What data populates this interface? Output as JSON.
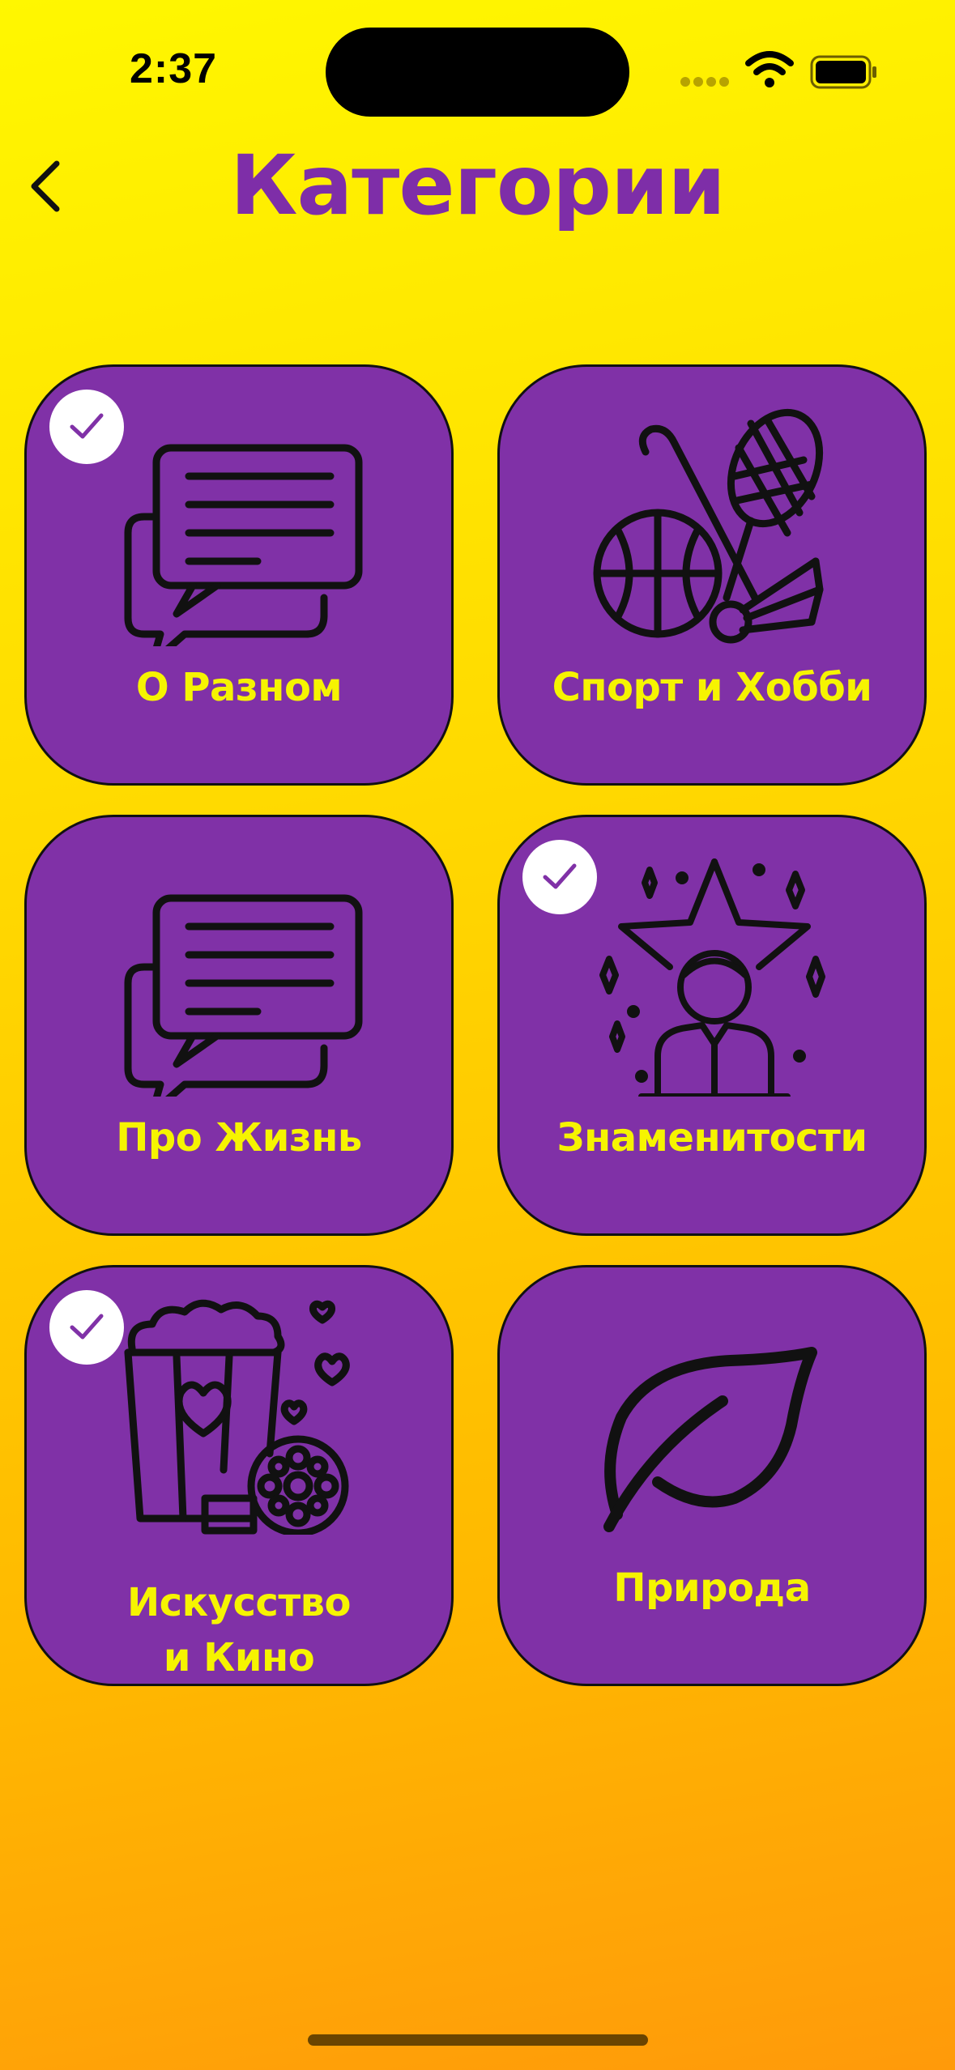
{
  "status_bar": {
    "time": "2:37"
  },
  "header": {
    "title": "Категории"
  },
  "colors": {
    "card": "#8031A7",
    "label": "#F6F400",
    "title": "#7E2EA8",
    "icon": "#111111"
  },
  "categories": [
    {
      "label": "О Разном",
      "selected": true,
      "icon": "chat-bubbles-icon"
    },
    {
      "label": "Спорт и Хобби",
      "selected": false,
      "icon": "sports-equipment-icon"
    },
    {
      "label": "Про Жизнь",
      "selected": false,
      "icon": "chat-bubbles-icon"
    },
    {
      "label": "Знаменитости",
      "selected": true,
      "icon": "celebrity-star-icon"
    },
    {
      "label_line1": "Искусство",
      "label_line2": "и Кино",
      "selected": true,
      "icon": "popcorn-film-icon"
    },
    {
      "label": "Природа",
      "selected": false,
      "icon": "leaf-icon"
    }
  ]
}
